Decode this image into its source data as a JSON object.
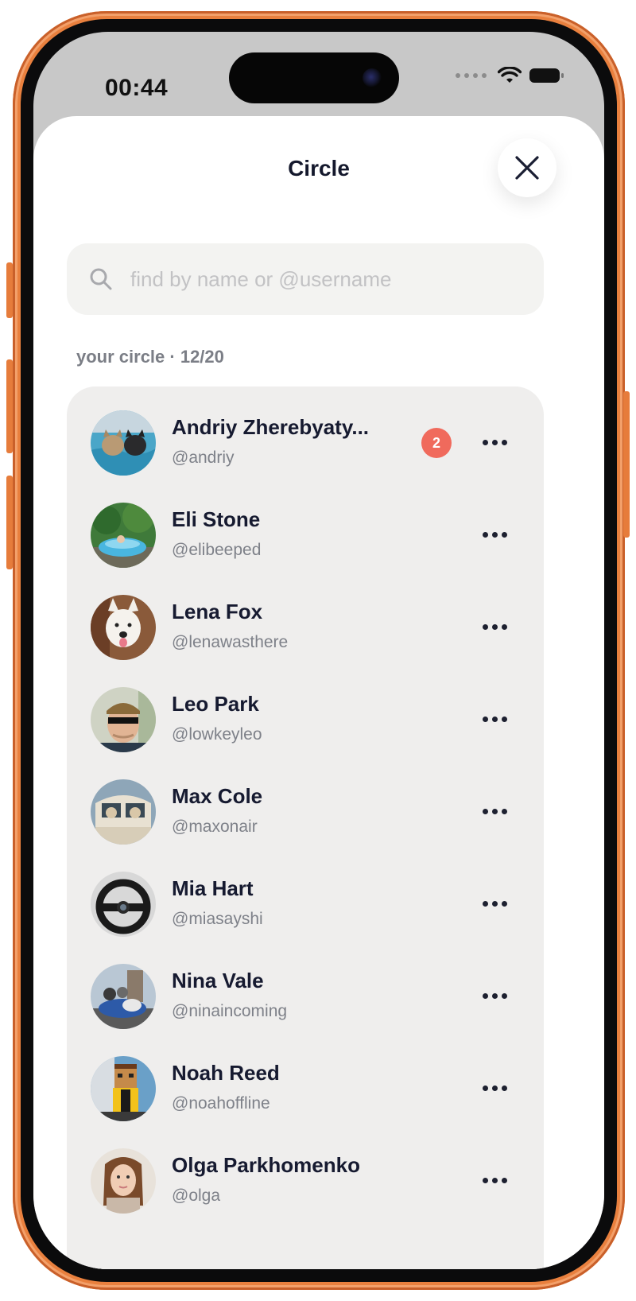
{
  "status_bar": {
    "time": "00:44"
  },
  "header": {
    "title": "Circle"
  },
  "search": {
    "placeholder": "find by name or @username"
  },
  "circle": {
    "label": "your circle · 12/20",
    "members": [
      {
        "name": "Andriy Zherebyaty...",
        "handle": "@andriy",
        "badge": "2"
      },
      {
        "name": "Eli Stone",
        "handle": "@elibeeped"
      },
      {
        "name": "Lena Fox",
        "handle": "@lenawasthere"
      },
      {
        "name": "Leo Park",
        "handle": "@lowkeyleo"
      },
      {
        "name": "Max Cole",
        "handle": "@maxonair"
      },
      {
        "name": "Mia Hart",
        "handle": "@miasayshi"
      },
      {
        "name": "Nina Vale",
        "handle": "@ninaincoming"
      },
      {
        "name": "Noah Reed",
        "handle": "@noahoffline"
      },
      {
        "name": "Olga Parkhomenko",
        "handle": "@olga"
      }
    ]
  },
  "colors": {
    "phone_frame": "#e9803e",
    "badge": "#f06a5c",
    "list_background": "#efeeed"
  }
}
